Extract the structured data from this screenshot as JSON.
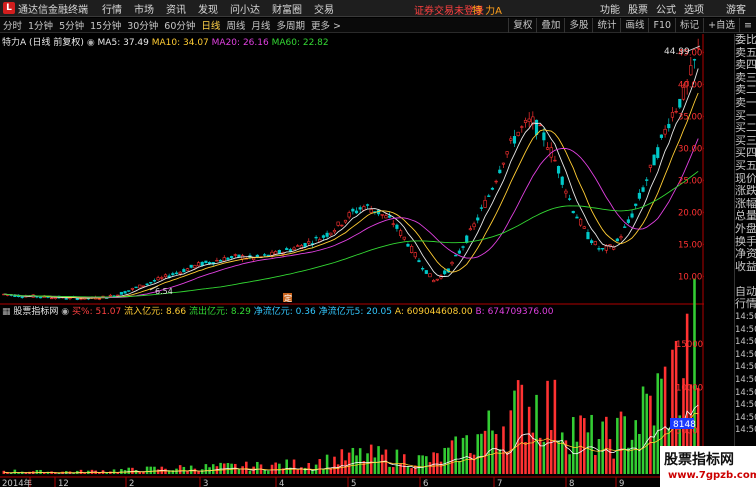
{
  "app": {
    "title": "通达信金融终端",
    "logo": "L"
  },
  "menu": [
    "行情",
    "市场",
    "资讯",
    "发现",
    "问小达",
    "财富圈",
    "交易"
  ],
  "login": {
    "status": "证券交易未登录",
    "stock": "特 力A"
  },
  "right_menu": [
    "功能",
    "股票",
    "公式",
    "选项"
  ],
  "guest": "游客",
  "periods": [
    "分时",
    "1分钟",
    "5分钟",
    "15分钟",
    "30分钟",
    "60分钟",
    "日线",
    "周线",
    "月线",
    "多周期",
    "更多 >"
  ],
  "active_period": "日线",
  "tools": [
    "复权",
    "叠加",
    "多股",
    "统计",
    "画线",
    "F10",
    "标记",
    "+自选",
    "≡"
  ],
  "stock": {
    "name": "特力A",
    "mode": "(日线 前复权)"
  },
  "ma": [
    {
      "label": "MA5: ",
      "value": "37.49",
      "color": "#e8e8e8"
    },
    {
      "label": "MA10: ",
      "value": "34.07",
      "color": "#ffcc33"
    },
    {
      "label": "MA20: ",
      "value": "26.16",
      "color": "#e040e0"
    },
    {
      "label": "MA60: ",
      "value": "22.82",
      "color": "#33d833"
    }
  ],
  "indicator": {
    "name": "股票指标网",
    "fields": [
      {
        "label": "买%: ",
        "value": "51.07",
        "color": "#ff4040"
      },
      {
        "label": "流入亿元: ",
        "value": "8.66",
        "color": "#ffcc33"
      },
      {
        "label": "流出亿元: ",
        "value": "8.29",
        "color": "#33d833"
      },
      {
        "label": "净流亿元: ",
        "value": "0.36",
        "color": "#33c8ff"
      },
      {
        "label": "净流亿元5: ",
        "value": "20.05",
        "color": "#33c8ff"
      },
      {
        "label": "A: ",
        "value": "609044608.00",
        "color": "#ffcc33"
      },
      {
        "label": "B: ",
        "value": "674709376.00",
        "color": "#e040e0"
      }
    ]
  },
  "annotations": {
    "high_price": "44.99",
    "low_price": "6.54",
    "ding": "定",
    "badge": "8148"
  },
  "right_panel": [
    "委比",
    "卖五",
    "卖四",
    "卖三",
    "卖二",
    "卖一",
    "买一",
    "买二",
    "买三",
    "买四",
    "买五",
    "现价",
    "涨跌",
    "涨幅",
    "总量",
    "外盘",
    "换手",
    "净资",
    "收益",
    "",
    "自动",
    "行情",
    "14:50",
    "14:50",
    "14:50",
    "14:50",
    "14:50",
    "14:50",
    "14:50",
    "14:50",
    "14:50",
    "14:50"
  ],
  "colors": {
    "up": "#ff3232",
    "down": "#00c8c8",
    "vol_up": "#ff3232",
    "vol_down": "#33cc33",
    "axis": "#b00000"
  },
  "watermark": {
    "title": "股票指标网",
    "url": "www.7gpzb.com"
  },
  "chart_data": [
    {
      "type": "candlestick",
      "title": "特力A (日线 前复权)",
      "y_ticks": [
        10.0,
        15.0,
        20.0,
        25.0,
        30.0,
        35.0,
        40.0,
        45.0
      ],
      "ylim": [
        6.0,
        46.0
      ],
      "x_ticks": [
        "2014年",
        "12",
        "2",
        "3",
        "4",
        "5",
        "6",
        "7",
        "8",
        "9"
      ],
      "high": 44.99,
      "low": 6.54,
      "close_path": [
        7.2,
        7.0,
        6.9,
        6.8,
        6.7,
        6.6,
        6.54,
        6.7,
        7.0,
        7.8,
        8.6,
        9.4,
        10.2,
        11.0,
        11.8,
        12.3,
        12.8,
        13.1,
        12.8,
        13.2,
        13.8,
        14.5,
        15.3,
        16.2,
        17.8,
        19.8,
        21.0,
        20.0,
        18.5,
        15.5,
        12.0,
        9.2,
        11.0,
        14.5,
        18.5,
        23.0,
        28.5,
        32.5,
        34.3,
        31.5,
        26.5,
        20.5,
        16.5,
        14.0,
        14.8,
        18.5,
        23.5,
        29.0,
        35.0,
        38.5,
        44.99
      ],
      "series": [
        {
          "name": "MA5",
          "value": 37.49
        },
        {
          "name": "MA10",
          "value": 34.07
        },
        {
          "name": "MA20",
          "value": 26.16
        },
        {
          "name": "MA60",
          "value": 22.82
        }
      ]
    },
    {
      "type": "bar",
      "title": "股票指标网",
      "y_ticks": [
        5000,
        10000,
        15000
      ],
      "ylim": [
        0,
        18000
      ],
      "volume_path": [
        400,
        380,
        350,
        320,
        300,
        330,
        360,
        420,
        480,
        520,
        600,
        680,
        720,
        800,
        850,
        900,
        950,
        980,
        1000,
        1050,
        1150,
        1250,
        1400,
        1600,
        1900,
        2200,
        2400,
        2300,
        2100,
        1900,
        1800,
        1900,
        2600,
        3500,
        4500,
        5600,
        6800,
        8000,
        9200,
        8800,
        7400,
        6000,
        5000,
        4500,
        4800,
        6000,
        7600,
        9500,
        11500,
        14500,
        17500
      ]
    }
  ]
}
